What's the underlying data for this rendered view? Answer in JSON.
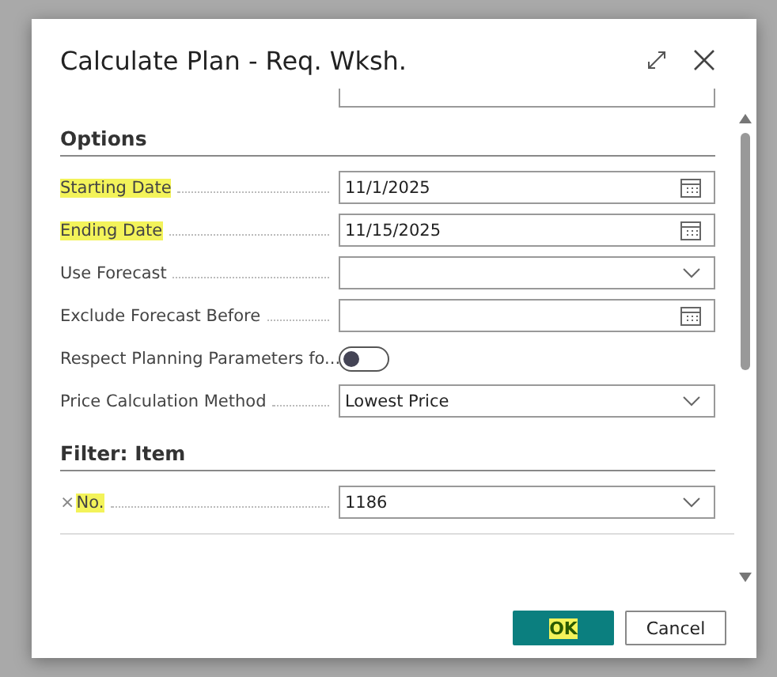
{
  "dialog": {
    "title": "Calculate Plan - Req. Wksh.",
    "sections": [
      {
        "title": "Options",
        "fields": [
          {
            "label": "Starting Date",
            "kind": "date",
            "value": "11/1/2025",
            "highlighted": true
          },
          {
            "label": "Ending Date",
            "kind": "date",
            "value": "11/15/2025",
            "highlighted": true
          },
          {
            "label": "Use Forecast",
            "kind": "dropdown",
            "highlighted": false
          },
          {
            "label": "Exclude Forecast Before",
            "kind": "date",
            "highlighted": false
          },
          {
            "label": "Respect Planning Parameters fo...",
            "kind": "toggle",
            "on": false,
            "highlighted": false
          },
          {
            "label": "Price Calculation Method",
            "kind": "dropdown",
            "value": "Lowest Price",
            "highlighted": false
          }
        ]
      },
      {
        "title": "Filter: Item",
        "fields": [
          {
            "label": "No.",
            "kind": "dropdown",
            "value": "1186",
            "highlighted": true,
            "removable": true,
            "remove_icon": "×"
          }
        ]
      }
    ],
    "buttons": [
      {
        "label": "OK",
        "primary": true,
        "highlighted": true
      },
      {
        "label": "Cancel",
        "primary": false,
        "highlighted": false
      }
    ]
  }
}
